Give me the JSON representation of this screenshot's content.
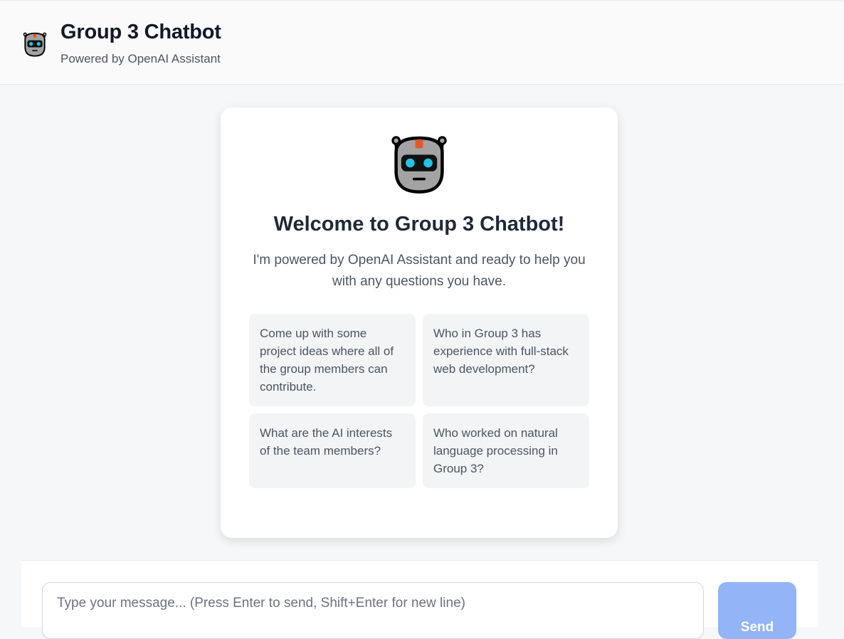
{
  "header": {
    "title": "Group 3 Chatbot",
    "subtitle": "Powered by OpenAI Assistant",
    "logo_icon": "robot-face-icon"
  },
  "welcome": {
    "icon": "robot-face-icon",
    "title": "Welcome to Group 3 Chatbot!",
    "description": "I'm powered by OpenAI Assistant and ready to help you with any questions you have.",
    "suggestions": [
      "Come up with some project ideas where all of the group members can contribute.",
      "Who in Group 3 has experience with full-stack web development?",
      "What are the AI interests of the team members?",
      "Who worked on natural language processing in Group 3?"
    ]
  },
  "composer": {
    "placeholder": "Type your message... (Press Enter to send, Shift+Enter for new line)",
    "value": "",
    "send_label": "Send"
  },
  "colors": {
    "accent": "#93b4f6",
    "card_bg": "#ffffff",
    "suggestion_bg": "#f3f4f6",
    "page_bg": "#f6f7f9"
  }
}
